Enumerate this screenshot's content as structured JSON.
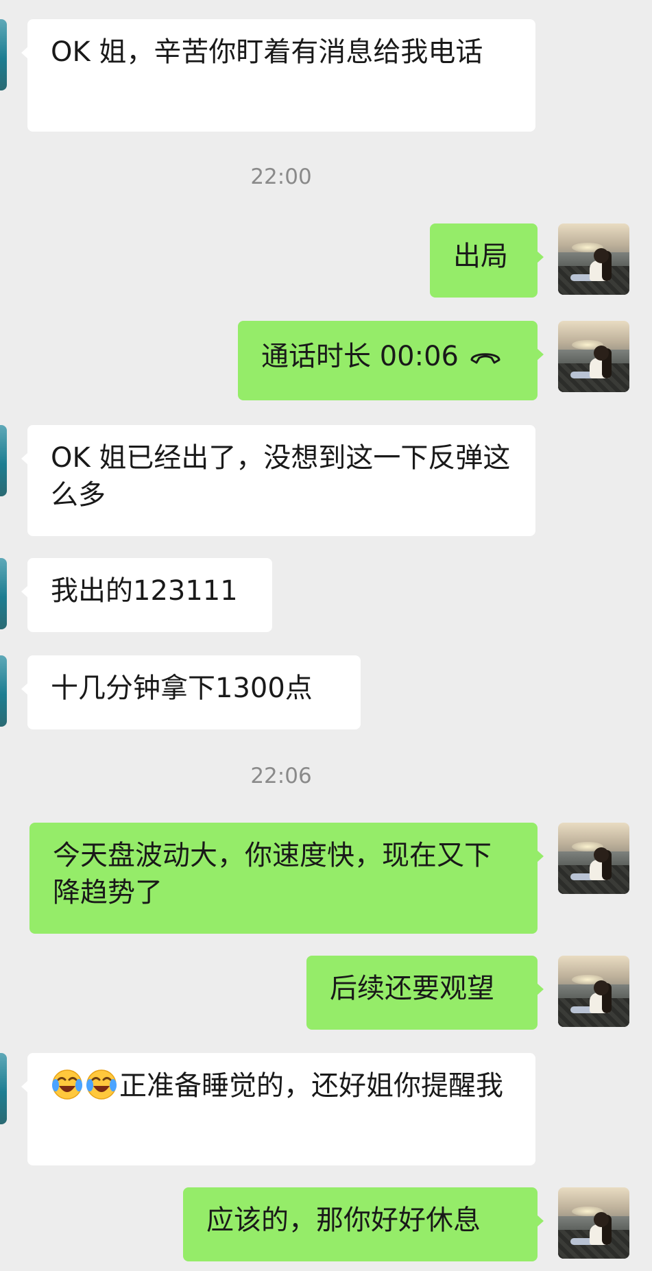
{
  "chat": {
    "timestamps": [
      "22:00",
      "22:06"
    ],
    "messages": [
      {
        "side": "left",
        "text": "OK 姐，辛苦你盯着有消息给我电话"
      },
      {
        "side": "right",
        "text": "出局"
      },
      {
        "side": "right",
        "text": "通话时长 00:06",
        "icon": "phone-hangup-icon"
      },
      {
        "side": "left",
        "text": "OK 姐已经出了，没想到这一下反弹这么多"
      },
      {
        "side": "left",
        "text": "我出的123111"
      },
      {
        "side": "left",
        "text": "十几分钟拿下1300点"
      },
      {
        "side": "right",
        "text": "今天盘波动大，你速度快，现在又下降趋势了"
      },
      {
        "side": "right",
        "text": "后续还要观望"
      },
      {
        "side": "left",
        "text": "正准备睡觉的，还好姐你提醒我",
        "prefix_icons": [
          "crying-laughing-emoji-icon",
          "crying-laughing-emoji-icon"
        ]
      },
      {
        "side": "right",
        "text": "应该的，那你好好休息"
      }
    ]
  },
  "colors": {
    "background": "#ededed",
    "incoming_bubble": "#ffffff",
    "outgoing_bubble": "#95ec69",
    "timestamp_text": "#8a8a8a"
  }
}
